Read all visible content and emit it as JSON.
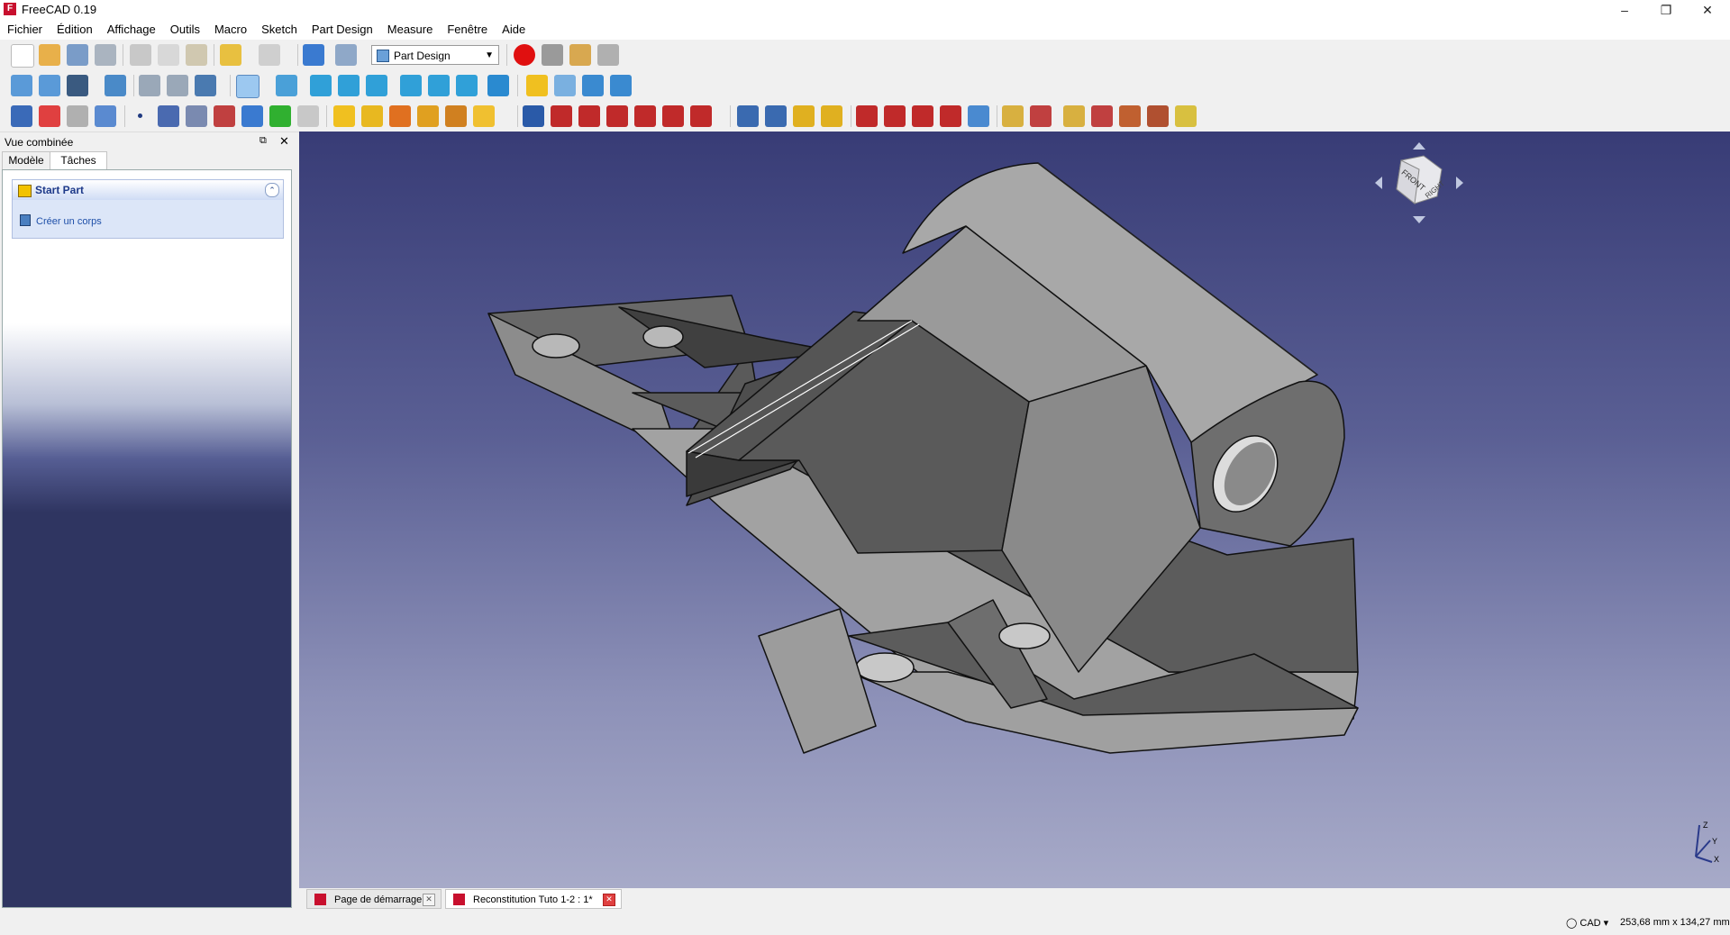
{
  "window": {
    "title": "FreeCAD 0.19",
    "minimize_icon": "minimize-icon",
    "restore_icon": "restore-icon",
    "close_icon": "close-icon"
  },
  "menu": [
    "Fichier",
    "Édition",
    "Affichage",
    "Outils",
    "Macro",
    "Sketch",
    "Part Design",
    "Measure",
    "Fenêtre",
    "Aide"
  ],
  "toolbar": {
    "workbench": "Part Design"
  },
  "combo_view": {
    "title": "Vue combinée",
    "tabs": [
      "Modèle",
      "Tâches"
    ],
    "active_tab": "Tâches",
    "task": {
      "header": "Start Part",
      "action": "Créer un corps"
    }
  },
  "navigation_cube": {
    "faces": [
      "FRONT",
      "RIGHT"
    ]
  },
  "axis_labels": [
    "Z",
    "Y",
    "X"
  ],
  "document_tabs": [
    {
      "label": "Page de démarrage",
      "active": false
    },
    {
      "label": "Reconstitution Tuto 1-2 : 1*",
      "active": true
    }
  ],
  "status": {
    "navigation_style": "CAD",
    "dimensions": "253,68 mm x 134,27 mm"
  },
  "colors": {
    "viewport_top": "#383c76",
    "viewport_bottom": "#a7aac8",
    "part_face": "#6e6e6e"
  }
}
